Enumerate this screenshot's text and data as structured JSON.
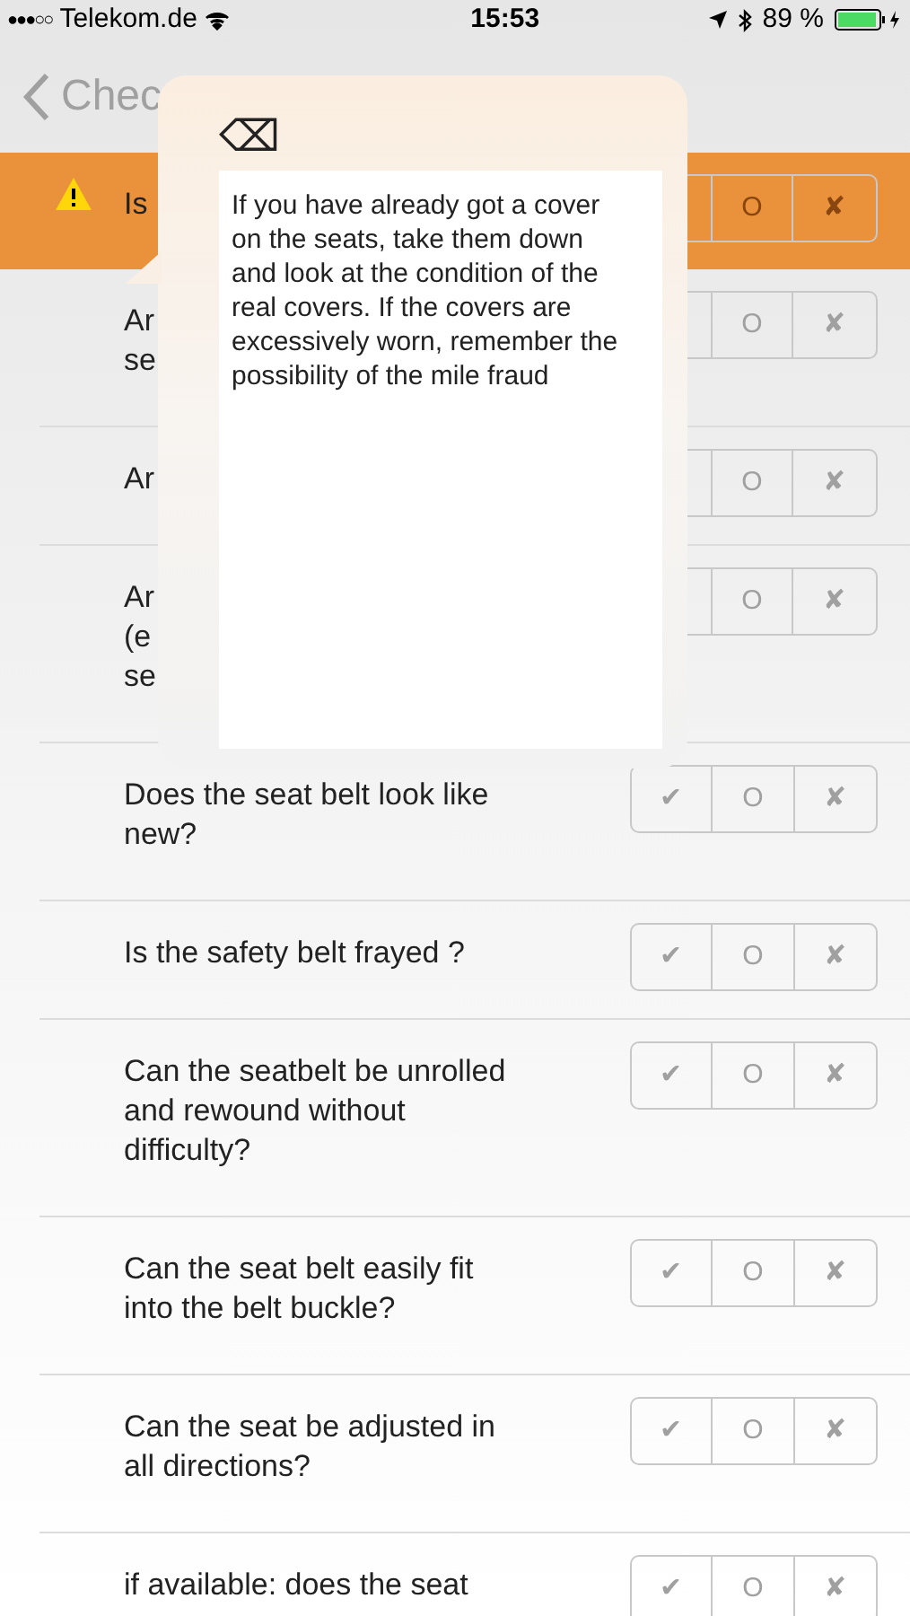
{
  "status_bar": {
    "signal": "●●●○○",
    "carrier": "Telekom.de",
    "time": "15:53",
    "battery": "89 %"
  },
  "nav": {
    "back": "Chec"
  },
  "rows": [
    {
      "text": "Is",
      "flagged": true,
      "options": [
        {
          "symbol": "O",
          "selected": false
        },
        {
          "symbol": "✘",
          "selected": false
        }
      ]
    },
    {
      "text": "Ar\nse",
      "flagged": false,
      "options": [
        {
          "symbol": "O",
          "selected": false
        },
        {
          "symbol": "✘",
          "selected": false
        }
      ]
    },
    {
      "text": "Ar",
      "flagged": false,
      "options": [
        {
          "symbol": "O",
          "selected": false
        },
        {
          "symbol": "✘",
          "selected": false
        }
      ]
    },
    {
      "text": "Ar\n(e\nse",
      "flagged": false,
      "options": [
        {
          "symbol": "O",
          "selected": false
        },
        {
          "symbol": "✘",
          "selected": false
        }
      ]
    },
    {
      "text": "Does the seat belt look like\nnew?",
      "flagged": false,
      "options": [
        {
          "symbol": "✔",
          "selected": false
        },
        {
          "symbol": "O",
          "selected": false
        },
        {
          "symbol": "✘",
          "selected": false
        }
      ]
    },
    {
      "text": "Is the safety belt frayed ?",
      "flagged": false,
      "options": [
        {
          "symbol": "✔",
          "selected": false
        },
        {
          "symbol": "O",
          "selected": false
        },
        {
          "symbol": "✘",
          "selected": false
        }
      ]
    },
    {
      "text": "Can the seatbelt be unrolled\nand rewound without\ndifficulty?",
      "flagged": false,
      "options": [
        {
          "symbol": "✔",
          "selected": false
        },
        {
          "symbol": "O",
          "selected": false
        },
        {
          "symbol": "✘",
          "selected": false
        }
      ]
    },
    {
      "text": "Can the seat belt easily fit\ninto the belt buckle?",
      "flagged": false,
      "options": [
        {
          "symbol": "✔",
          "selected": false
        },
        {
          "symbol": "O",
          "selected": false
        },
        {
          "symbol": "✘",
          "selected": false
        }
      ]
    },
    {
      "text": "Can the seat be adjusted in\nall directions?",
      "flagged": false,
      "options": [
        {
          "symbol": "✔",
          "selected": false
        },
        {
          "symbol": "O",
          "selected": false
        },
        {
          "symbol": "✘",
          "selected": false
        }
      ]
    },
    {
      "text": "if available: does the seat",
      "flagged": false,
      "options": [
        {
          "symbol": "✔",
          "selected": false
        },
        {
          "symbol": "O",
          "selected": false
        },
        {
          "symbol": "✘",
          "selected": false
        }
      ]
    }
  ],
  "popup": {
    "close": "⌫",
    "body": "If you have already got a cover on the seats, take them down and look at the condition of the real covers. If the covers are excessively worn, remember the possibility of the mile fraud"
  }
}
